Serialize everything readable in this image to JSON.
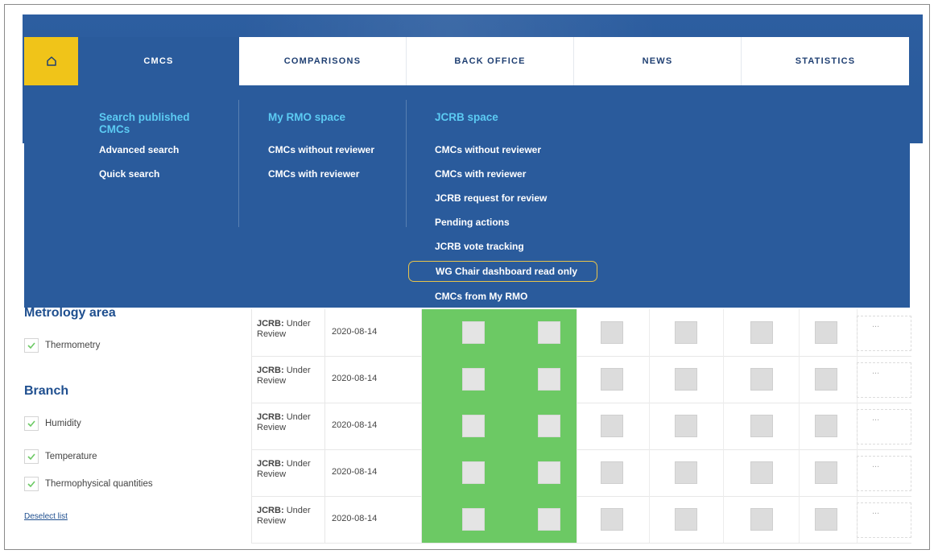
{
  "nav": {
    "home_icon": "home-icon",
    "tabs": [
      {
        "label": "CMCs"
      },
      {
        "label": "Comparisons"
      },
      {
        "label": "Back office"
      },
      {
        "label": "News"
      },
      {
        "label": "Statistics"
      }
    ]
  },
  "menu": {
    "search": {
      "title": "Search published CMCs",
      "items": [
        "Advanced search",
        "Quick search"
      ]
    },
    "rmo": {
      "title": "My RMO space",
      "items": [
        "CMCs without reviewer",
        "CMCs with reviewer"
      ]
    },
    "jcrb": {
      "title": "JCRB space",
      "items": [
        "CMCs without reviewer",
        "CMCs with reviewer",
        "JCRB request for review",
        "Pending actions",
        "JCRB vote tracking",
        "WG Chair dashboard read only",
        "CMCs from My RMO"
      ]
    }
  },
  "sidebar": {
    "metrology_area": "Metrology area",
    "metrology_items": [
      "Thermometry"
    ],
    "branch": "Branch",
    "branch_items": [
      "Humidity",
      "Temperature",
      "Thermophysical quantities"
    ],
    "deselect": "Deselect list"
  },
  "table": {
    "rows": [
      {
        "status_bold": "JCRB:",
        "status_rest": "Under",
        "status_line2": "Review",
        "date": "2020-08-14",
        "more": "..."
      },
      {
        "status_bold": "JCRB:",
        "status_rest": "Under",
        "status_line2": "Review",
        "date": "2020-08-14",
        "more": "..."
      },
      {
        "status_bold": "JCRB:",
        "status_rest": "Under",
        "status_line2": "Review",
        "date": "2020-08-14",
        "more": "..."
      },
      {
        "status_bold": "JCRB:",
        "status_rest": "Under",
        "status_line2": "Review",
        "date": "2020-08-14",
        "more": "..."
      },
      {
        "status_bold": "JCRB:",
        "status_rest": "Under",
        "status_line2": "Review",
        "date": "2020-08-14",
        "more": "..."
      }
    ]
  },
  "colors": {
    "nav_blue": "#2a5b9c",
    "home_yellow": "#f0c419",
    "title_cyan": "#5ccbf3",
    "highlight_border": "#e9c44a",
    "green": "#6cc964"
  }
}
